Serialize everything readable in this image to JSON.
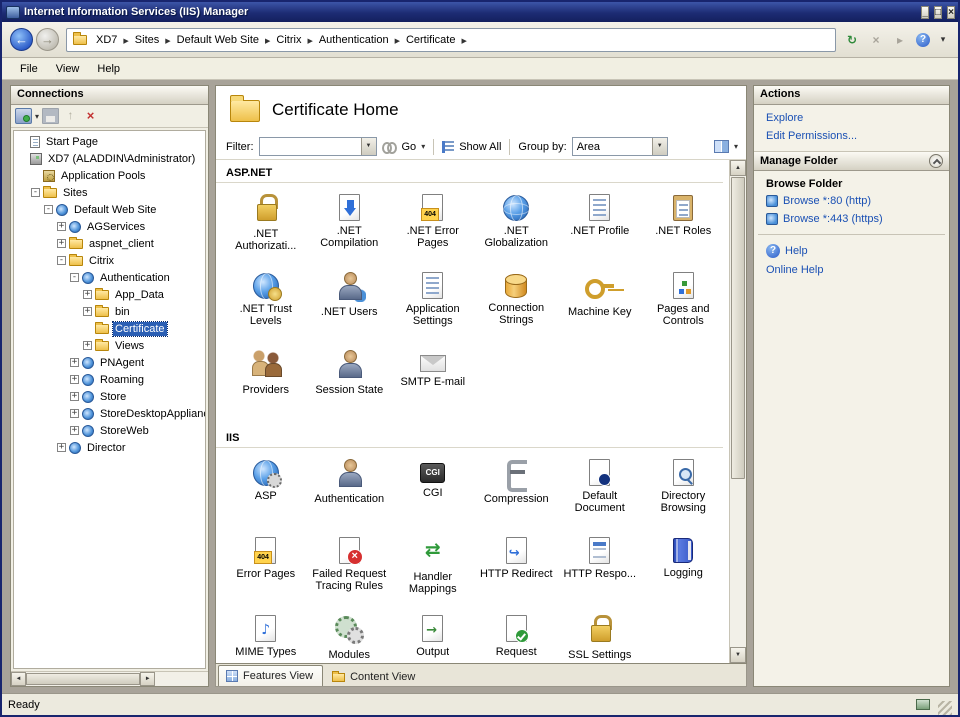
{
  "window": {
    "title": "Internet Information Services (IIS) Manager",
    "status": "Ready"
  },
  "menu": {
    "items": [
      "File",
      "View",
      "Help"
    ]
  },
  "breadcrumb": {
    "items": [
      "XD7",
      "Sites",
      "Default Web Site",
      "Citrix",
      "Authentication",
      "Certificate"
    ]
  },
  "connections": {
    "title": "Connections",
    "tree": [
      {
        "label": "Start Page",
        "level": 0,
        "expander": "",
        "icon": "page",
        "selected": false
      },
      {
        "label": "XD7 (ALADDIN\\Administrator)",
        "level": 0,
        "expander": "",
        "icon": "server",
        "selected": false
      },
      {
        "label": "Application Pools",
        "level": 1,
        "expander": "",
        "icon": "apppool",
        "selected": false
      },
      {
        "label": "Sites",
        "level": 1,
        "expander": "-",
        "icon": "sites",
        "selected": false
      },
      {
        "label": "Default Web Site",
        "level": 2,
        "expander": "-",
        "icon": "site",
        "selected": false
      },
      {
        "label": "AGServices",
        "level": 3,
        "expander": "+",
        "icon": "app",
        "selected": false
      },
      {
        "label": "aspnet_client",
        "level": 3,
        "expander": "+",
        "icon": "folder",
        "selected": false
      },
      {
        "label": "Citrix",
        "level": 3,
        "expander": "-",
        "icon": "folder",
        "selected": false
      },
      {
        "label": "Authentication",
        "level": 4,
        "expander": "-",
        "icon": "app",
        "selected": false
      },
      {
        "label": "App_Data",
        "level": 5,
        "expander": "+",
        "icon": "folder",
        "selected": false
      },
      {
        "label": "bin",
        "level": 5,
        "expander": "+",
        "icon": "folder",
        "selected": false
      },
      {
        "label": "Certificate",
        "level": 5,
        "expander": "",
        "icon": "folder",
        "selected": true
      },
      {
        "label": "Views",
        "level": 5,
        "expander": "+",
        "icon": "folder",
        "selected": false
      },
      {
        "label": "PNAgent",
        "level": 4,
        "expander": "+",
        "icon": "app",
        "selected": false
      },
      {
        "label": "Roaming",
        "level": 4,
        "expander": "+",
        "icon": "app",
        "selected": false
      },
      {
        "label": "Store",
        "level": 4,
        "expander": "+",
        "icon": "app",
        "selected": false
      },
      {
        "label": "StoreDesktopAppliance",
        "level": 4,
        "expander": "+",
        "icon": "app",
        "selected": false
      },
      {
        "label": "StoreWeb",
        "level": 4,
        "expander": "+",
        "icon": "app",
        "selected": false
      },
      {
        "label": "Director",
        "level": 3,
        "expander": "+",
        "icon": "app",
        "selected": false
      }
    ]
  },
  "main": {
    "title": "Certificate Home",
    "filter": {
      "label": "Filter:",
      "value": "",
      "go": "Go",
      "show_all": "Show All",
      "group_by_label": "Group by:",
      "group_by_value": "Area"
    },
    "groups": [
      {
        "name": "ASP.NET",
        "items": [
          {
            "label": ".NET Authorizati...",
            "icon": "net-auth"
          },
          {
            "label": ".NET Compilation",
            "icon": "net-compile"
          },
          {
            "label": ".NET Error Pages",
            "icon": "error-404"
          },
          {
            "label": ".NET Globalization",
            "icon": "globe"
          },
          {
            "label": ".NET Profile",
            "icon": "profile"
          },
          {
            "label": ".NET Roles",
            "icon": "roles"
          },
          {
            "label": ".NET Trust Levels",
            "icon": "trust"
          },
          {
            "label": ".NET Users",
            "icon": "users"
          },
          {
            "label": "Application Settings",
            "icon": "app-settings"
          },
          {
            "label": "Connection Strings",
            "icon": "conn-strings"
          },
          {
            "label": "Machine Key",
            "icon": "machine-key"
          },
          {
            "label": "Pages and Controls",
            "icon": "pages-controls"
          },
          {
            "label": "Providers",
            "icon": "providers"
          },
          {
            "label": "Session State",
            "icon": "session-state"
          },
          {
            "label": "SMTP E-mail",
            "icon": "smtp"
          }
        ]
      },
      {
        "name": "IIS",
        "items": [
          {
            "label": "ASP",
            "icon": "asp"
          },
          {
            "label": "Authentication",
            "icon": "authentication"
          },
          {
            "label": "CGI",
            "icon": "cgi"
          },
          {
            "label": "Compression",
            "icon": "compression"
          },
          {
            "label": "Default Document",
            "icon": "default-doc"
          },
          {
            "label": "Directory Browsing",
            "icon": "dir-browse"
          },
          {
            "label": "Error Pages",
            "icon": "error-404"
          },
          {
            "label": "Failed Request Tracing Rules",
            "icon": "failed-tracing"
          },
          {
            "label": "Handler Mappings",
            "icon": "handler-mappings"
          },
          {
            "label": "HTTP Redirect",
            "icon": "http-redirect"
          },
          {
            "label": "HTTP Respo...",
            "icon": "http-response"
          },
          {
            "label": "Logging",
            "icon": "logging"
          },
          {
            "label": "MIME Types",
            "icon": "mime"
          },
          {
            "label": "Modules",
            "icon": "modules"
          },
          {
            "label": "Output",
            "icon": "output"
          },
          {
            "label": "Request",
            "icon": "request"
          },
          {
            "label": "SSL Settings",
            "icon": "ssl"
          }
        ]
      }
    ],
    "tabs": [
      {
        "label": "Features View",
        "selected": true
      },
      {
        "label": "Content View",
        "selected": false
      }
    ]
  },
  "actions": {
    "title": "Actions",
    "links": [
      {
        "label": "Explore",
        "icon": ""
      },
      {
        "label": "Edit Permissions...",
        "icon": ""
      }
    ],
    "manage_folder": {
      "title": "Manage Folder",
      "subtitle": "Browse Folder",
      "links": [
        {
          "label": "Browse *:80 (http)",
          "icon": "browse"
        },
        {
          "label": "Browse *:443 (https)",
          "icon": "browse"
        }
      ]
    },
    "help": {
      "links": [
        {
          "label": "Help",
          "icon": "help"
        },
        {
          "label": "Online Help",
          "icon": ""
        }
      ]
    }
  },
  "icons": {
    "back": "←",
    "forward": "→",
    "crumb_sep": "▶",
    "minimize": "_",
    "maximize": "□",
    "close": "×",
    "refresh": "↻",
    "stop": "×",
    "pin": "▸",
    "help": "?",
    "chevron": "▾",
    "scroll_up": "▲",
    "scroll_down": "▼",
    "scroll_left": "◄",
    "scroll_right": "►",
    "combo_arrow": "▼",
    "up": "↑",
    "delete": "×"
  },
  "colors": {
    "titlebar": "#1d2c74",
    "selection": "#2b5fb4",
    "link": "#1a50b4",
    "workspace": "#a8a399"
  }
}
